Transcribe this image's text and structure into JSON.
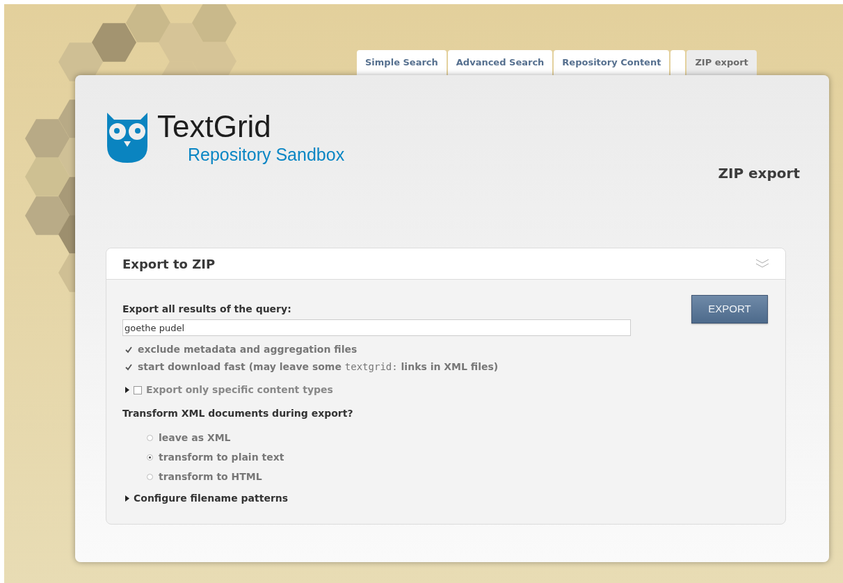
{
  "tabs": [
    {
      "kind": "label",
      "label": "Simple Search",
      "selected": false
    },
    {
      "kind": "label",
      "label": "Advanced Search",
      "selected": false
    },
    {
      "kind": "label",
      "label": "Repository Content",
      "selected": false
    },
    {
      "kind": "blank",
      "selected": false
    },
    {
      "kind": "label",
      "label": "ZIP export",
      "selected": true
    }
  ],
  "logo": {
    "title": "TextGrid",
    "subtitle": "Repository Sandbox"
  },
  "page_title": "ZIP export",
  "panel": {
    "title": "Export to ZIP",
    "expanded": true,
    "query_label": "Export all results of the query:",
    "query_value": "goethe pudel",
    "export_button": "EXPORT",
    "options": [
      {
        "checked": true,
        "parts": [
          {
            "kind": "text",
            "text": "exclude metadata and aggregation files"
          }
        ]
      },
      {
        "checked": true,
        "parts": [
          {
            "kind": "text",
            "text": "start download fast (may leave some "
          },
          {
            "kind": "code",
            "text": "textgrid:"
          },
          {
            "kind": "text",
            "text": " links in XML files)"
          }
        ]
      }
    ],
    "content_types": {
      "label": "Export only specific content types",
      "expanded": false,
      "checked": false
    },
    "transform_label": "Transform XML documents during export?",
    "transform_options": [
      {
        "label": "leave as XML",
        "selected": false
      },
      {
        "label": "transform to plain text",
        "selected": true
      },
      {
        "label": "transform to HTML",
        "selected": false
      }
    ],
    "filename_patterns": {
      "label": "Configure filename patterns",
      "expanded": false
    }
  }
}
